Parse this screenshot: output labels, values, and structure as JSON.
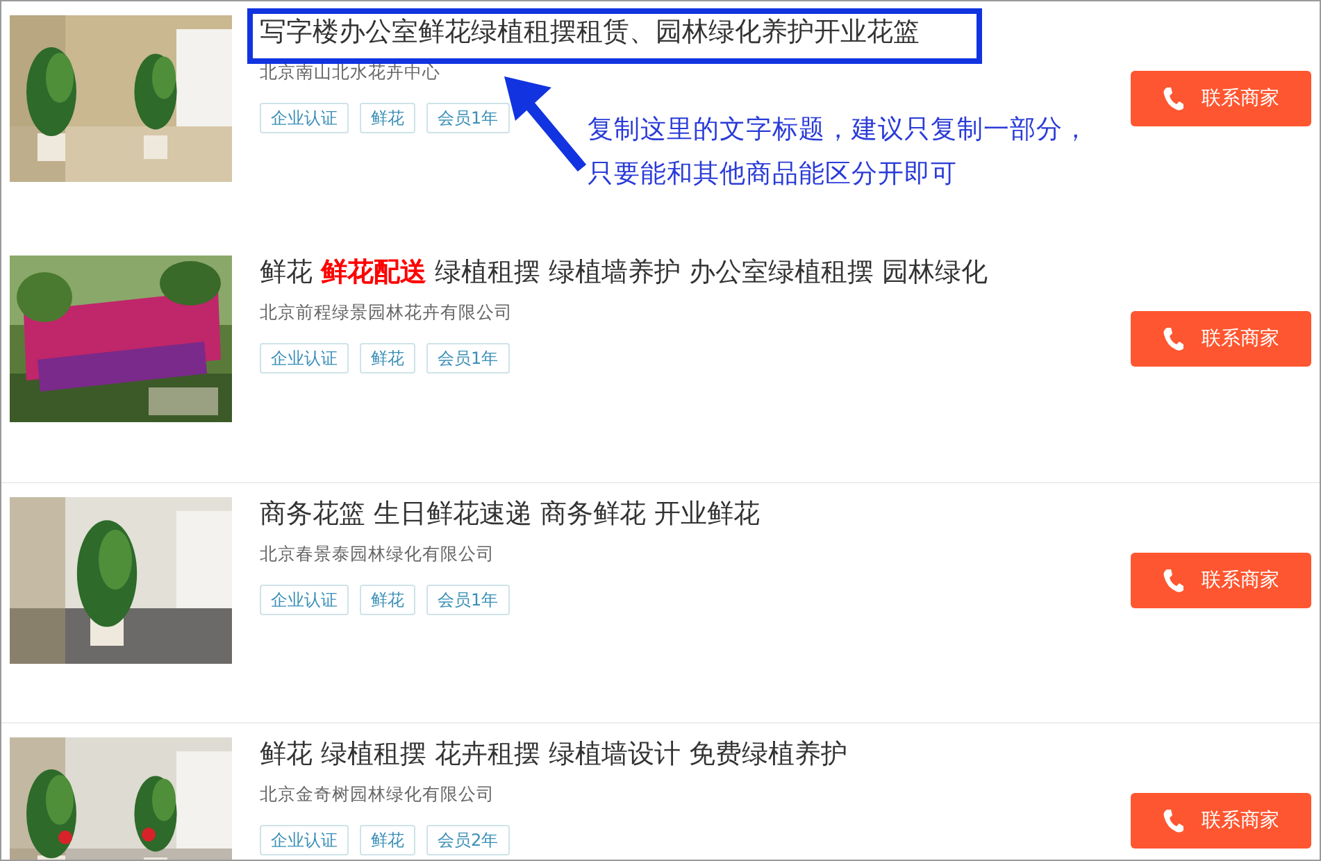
{
  "listings": [
    {
      "kind": "picture",
      "title": "写字楼办公室鲜花绿植租摆租赁、园林绿化养护开业花篮",
      "company": "北京南山北水花卉中心",
      "tags": [
        "企业认证",
        "鲜花",
        "会员1年"
      ],
      "button": "联系商家",
      "annotation": {
        "lines": [
          "复制这里的文字标题，建议只复制一部分，",
          "只要能和其他商品能区分开即可"
        ]
      }
    },
    {
      "kind": "picture",
      "title": "鲜花 **鲜花配送** 绿植租摆 绿植墙养护 办公室绿植租摆 园林绿化",
      "company": "北京前程绿景园林花卉有限公司",
      "tags": [
        "企业认证",
        "鲜花",
        "会员1年"
      ],
      "button": "联系商家"
    },
    {
      "kind": "picture",
      "title": "商务花篮 生日鲜花速递 商务鲜花 开业鲜花",
      "company": "北京春景泰园林绿化有限公司",
      "tags": [
        "企业认证",
        "鲜花",
        "会员1年"
      ],
      "button": "联系商家"
    },
    {
      "kind": "picture",
      "title": "鲜花 绿植租摆 花卉租摆 绿植墙设计 免费绿植养护",
      "company": "北京金奇树园林绿化有限公司",
      "tags": [
        "企业认证",
        "鲜花",
        "会员2年"
      ],
      "button": "联系商家"
    }
  ]
}
